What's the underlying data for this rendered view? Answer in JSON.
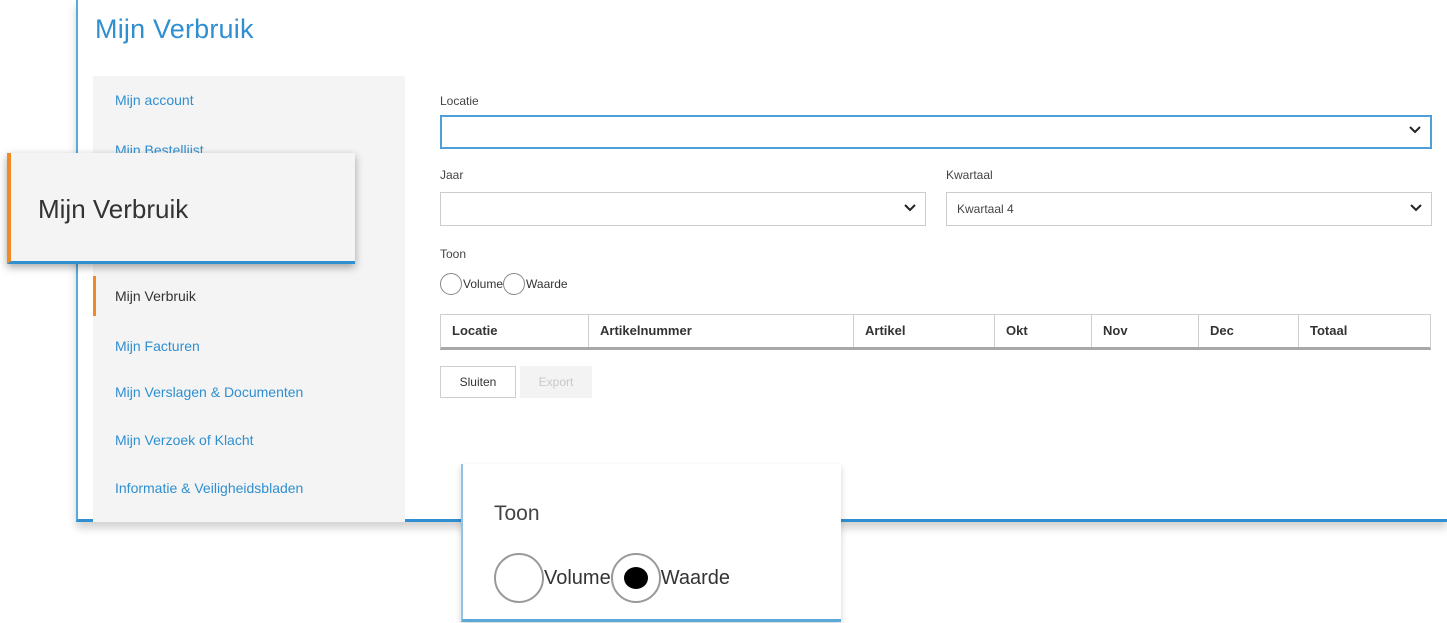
{
  "page": {
    "title": "Mijn Verbruik"
  },
  "sidebar": {
    "items": [
      {
        "label": "Mijn account"
      },
      {
        "label": "Mijn Bestellijst"
      },
      {
        "label": "Mijn Verbruik"
      },
      {
        "label": "Mijn Facturen"
      },
      {
        "label": "Mijn Verslagen & Documenten"
      },
      {
        "label": "Mijn Verzoek of Klacht"
      },
      {
        "label": "Informatie & Veiligheidsbladen"
      }
    ]
  },
  "form": {
    "locatie_label": "Locatie",
    "locatie_value": "",
    "jaar_label": "Jaar",
    "jaar_value": "",
    "kwartaal_label": "Kwartaal",
    "kwartaal_value": "Kwartaal 4",
    "toon_label": "Toon",
    "radio_volume": "Volume",
    "radio_waarde": "Waarde"
  },
  "table": {
    "columns": [
      "Locatie",
      "Artikelnummer",
      "Artikel",
      "Okt",
      "Nov",
      "Dec",
      "Totaal"
    ]
  },
  "buttons": {
    "close": "Sluiten",
    "export": "Export"
  },
  "zoom1": {
    "label": "Mijn Verbruik"
  },
  "zoom2": {
    "toon": "Toon",
    "volume": "Volume",
    "waarde": "Waarde",
    "selected": "Waarde"
  },
  "colors": {
    "accent": "#2f8fd0",
    "active_marker": "#f08a24"
  }
}
